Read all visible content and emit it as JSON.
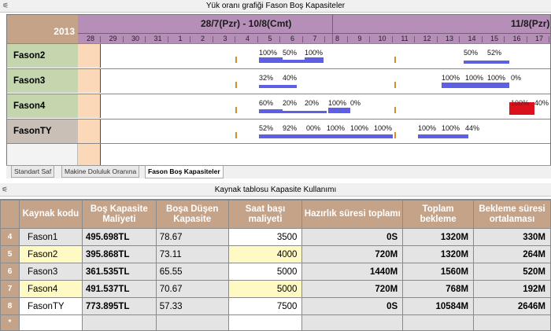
{
  "top_window": {
    "title": "Yük oranı grafiği   Fason Boş Kapasiteler",
    "year": "2013",
    "periods": [
      {
        "label": "28/7(Pzr) - 10/8(Cmt)"
      },
      {
        "label": "11/8(Pzr) - 1"
      }
    ],
    "days": [
      "28",
      "29",
      "30",
      "31",
      "1",
      "2",
      "3",
      "4",
      "5",
      "6",
      "7",
      "8",
      "9",
      "10",
      "11",
      "12",
      "13",
      "14",
      "15",
      "16",
      "17"
    ],
    "rows": [
      {
        "name": "Fason2",
        "labels": [
          "100%",
          "50%",
          "100%",
          "50%",
          "52%"
        ]
      },
      {
        "name": "Fason3",
        "labels": [
          "32%",
          "40%",
          "100%",
          "100%",
          "100%",
          "0%"
        ]
      },
      {
        "name": "Fason4",
        "labels": [
          "60%",
          "20%",
          "20%",
          "100%",
          "0%",
          "100%",
          "40%"
        ]
      },
      {
        "name": "FasonTY",
        "labels": [
          "52%",
          "92%",
          "00%",
          "100%",
          "100%",
          "100%",
          "100%",
          "100%",
          "44%"
        ]
      }
    ],
    "tabs": [
      "Standart Saf",
      "Makine Doluluk Oranına",
      "Fason Boş Kapasiteler"
    ]
  },
  "bottom_window": {
    "title": "Kaynak tablosu   Kapasite Kullanımı",
    "columns": [
      "Kaynak kodu",
      "Boş Kapasite Maliyeti",
      "Boşa Düşen Kapasite",
      "Saat başı maliyeti",
      "Hazırlık süresi toplamı",
      "Toplam bekleme",
      "Bekleme süresi ortalaması"
    ],
    "rows": [
      {
        "sel": "4",
        "kod": "Fason1",
        "bos": "495.698TL",
        "bosa": "78.67",
        "saat": "3500",
        "hazirlik": "0S",
        "toplam": "1320M",
        "ort": "330M"
      },
      {
        "sel": "5",
        "kod": "Fason2",
        "bos": "395.868TL",
        "bosa": "73.11",
        "saat": "4000",
        "hazirlik": "720M",
        "toplam": "1320M",
        "ort": "264M"
      },
      {
        "sel": "6",
        "kod": "Fason3",
        "bos": "361.535TL",
        "bosa": "65.55",
        "saat": "5000",
        "hazirlik": "1440M",
        "toplam": "1560M",
        "ort": "520M"
      },
      {
        "sel": "7",
        "kod": "Fason4",
        "bos": "491.537TL",
        "bosa": "70.67",
        "saat": "5000",
        "hazirlik": "720M",
        "toplam": "768M",
        "ort": "192M"
      },
      {
        "sel": "8",
        "kod": "FasonTY",
        "bos": "773.895TL",
        "bosa": "57.33",
        "saat": "7500",
        "hazirlik": "0S",
        "toplam": "10584M",
        "ort": "2646M"
      }
    ],
    "new_row_marker": "*"
  },
  "colors": {
    "header_brown": "#c5a389",
    "period_purple": "#b58fb8",
    "row_label_green": "#c5d6ae",
    "bar_blue": "#5f5fe6",
    "bar_red": "#d9121b",
    "highlight_yellow": "#fff9c4"
  }
}
